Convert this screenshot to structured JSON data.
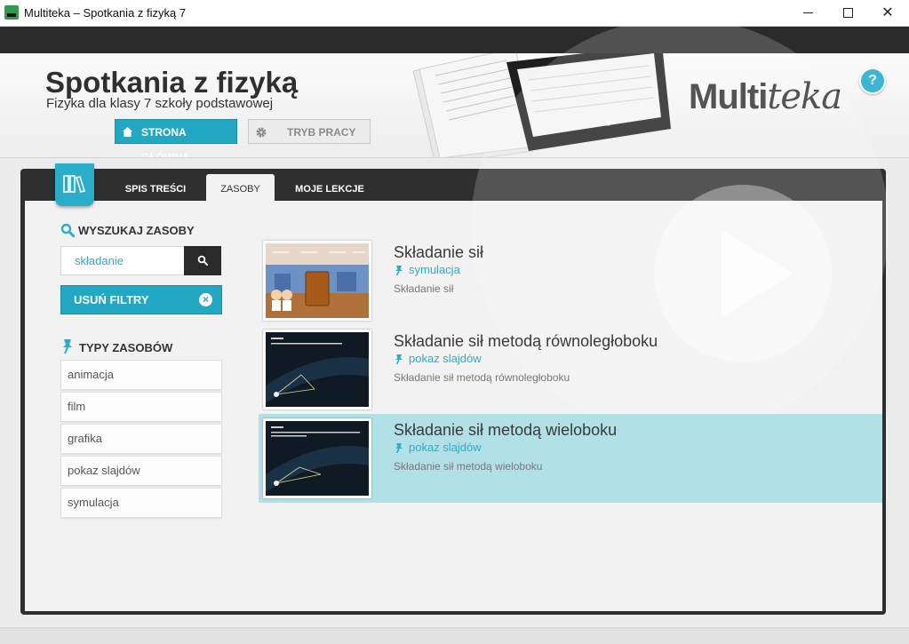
{
  "window": {
    "title": "Multiteka – Spotkania z fizyką 7",
    "controls": [
      "minimize",
      "maximize",
      "close"
    ]
  },
  "header": {
    "app_name": "Spotkania z fizyką",
    "subtitle": "Fizyka dla klasy 7 szkoły podstawowej",
    "home_button": "STRONA GŁÓWNA",
    "mode_button": "TRYB PRACY",
    "brand_bold": "Multi",
    "brand_italic": "teka",
    "help": "?"
  },
  "tabs": [
    {
      "label": "SPIS TREŚCI",
      "active": false
    },
    {
      "label": "ZASOBY",
      "active": true
    },
    {
      "label": "MOJE LEKCJE",
      "active": false
    }
  ],
  "search": {
    "title": "WYSZUKAJ ZASOBY",
    "value": "składanie",
    "clear_filters": "USUŃ FILTRY"
  },
  "types": {
    "title": "TYPY ZASOBÓW",
    "items": [
      "animacja",
      "film",
      "grafika",
      "pokaz slajdów",
      "symulacja"
    ]
  },
  "results": [
    {
      "title": "Składanie sił",
      "type": "symulacja",
      "description": "Składanie sił",
      "active": false
    },
    {
      "title": "Składanie sił metodą równoległoboku",
      "type": "pokaz slajdów",
      "description": "Składanie sił metodą równoległoboku",
      "active": false
    },
    {
      "title": "Składanie sił metodą wieloboku",
      "type": "pokaz slajdów",
      "description": "Składanie sił metodą wieloboku",
      "active": true
    }
  ],
  "colors": {
    "accent": "#23a8c4",
    "active_row": "#b2e0e7",
    "frame": "#2f2f2f"
  }
}
